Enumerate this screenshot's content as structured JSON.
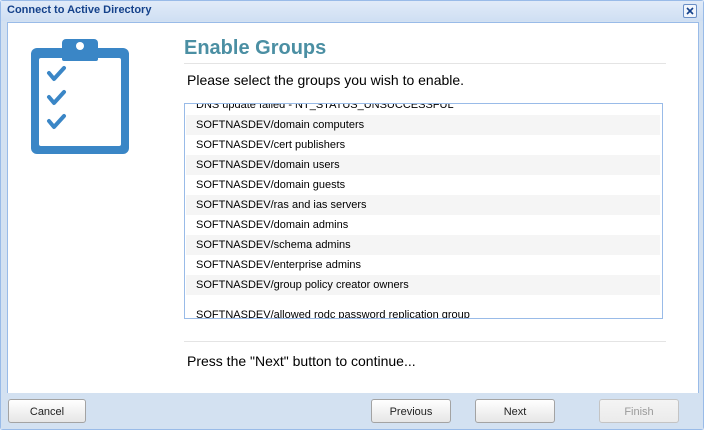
{
  "window": {
    "title": "Connect to Active Directory"
  },
  "main": {
    "heading": "Enable Groups",
    "instruction": "Please select the groups you wish to enable.",
    "footer": "Press the \"Next\" button to continue..."
  },
  "groups": {
    "items": [
      "DNS update failed - NT_STATUS_UNSUCCESSFUL",
      "SOFTNASDEV/domain computers",
      "SOFTNASDEV/cert publishers",
      "SOFTNASDEV/domain users",
      "SOFTNASDEV/domain guests",
      "SOFTNASDEV/ras and ias servers",
      "SOFTNASDEV/domain admins",
      "SOFTNASDEV/schema admins",
      "SOFTNASDEV/enterprise admins",
      "SOFTNASDEV/group policy creator owners",
      "SOFTNASDEV/allowed rodc password replication group"
    ]
  },
  "buttons": {
    "cancel": "Cancel",
    "previous": "Previous",
    "next": "Next",
    "finish": "Finish"
  },
  "icons": {
    "header": "clipboard-checklist-icon",
    "close": "close-icon"
  },
  "colors": {
    "accent": "#4b8fa3",
    "title": "#15428b",
    "icon": "#3a86c6"
  }
}
